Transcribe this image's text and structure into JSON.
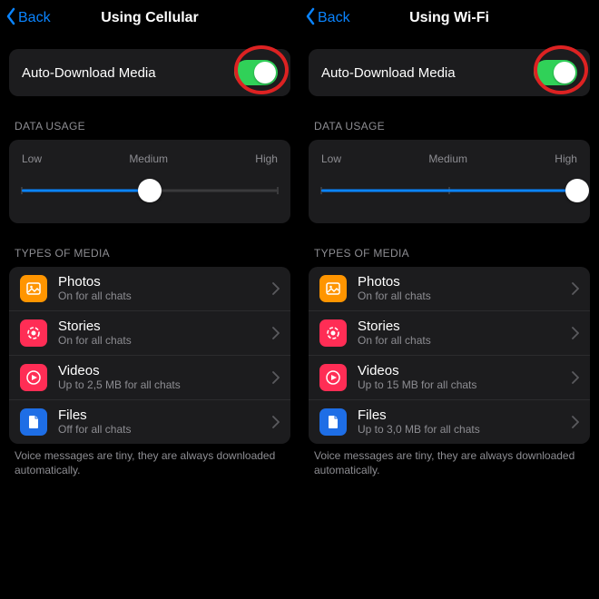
{
  "panes": [
    {
      "back": "Back",
      "title": "Using Cellular",
      "auto": {
        "label": "Auto-Download Media",
        "on": true
      },
      "dataUsage": {
        "header": "DATA USAGE",
        "low": "Low",
        "medium": "Medium",
        "high": "High",
        "valuePct": 50
      },
      "types": {
        "header": "TYPES OF MEDIA",
        "items": [
          {
            "icon": "photos",
            "title": "Photos",
            "sub": "On for all chats"
          },
          {
            "icon": "stories",
            "title": "Stories",
            "sub": "On for all chats"
          },
          {
            "icon": "videos",
            "title": "Videos",
            "sub": "Up to 2,5 MB for all chats"
          },
          {
            "icon": "files",
            "title": "Files",
            "sub": "Off for all chats"
          }
        ],
        "footnote": "Voice messages are tiny, they are always downloaded automatically."
      }
    },
    {
      "back": "Back",
      "title": "Using Wi-Fi",
      "auto": {
        "label": "Auto-Download Media",
        "on": true
      },
      "dataUsage": {
        "header": "DATA USAGE",
        "low": "Low",
        "medium": "Medium",
        "high": "High",
        "valuePct": 100
      },
      "types": {
        "header": "TYPES OF MEDIA",
        "items": [
          {
            "icon": "photos",
            "title": "Photos",
            "sub": "On for all chats"
          },
          {
            "icon": "stories",
            "title": "Stories",
            "sub": "On for all chats"
          },
          {
            "icon": "videos",
            "title": "Videos",
            "sub": "Up to 15 MB for all chats"
          },
          {
            "icon": "files",
            "title": "Files",
            "sub": "Up to 3,0 MB for all chats"
          }
        ],
        "footnote": "Voice messages are tiny, they are always downloaded automatically."
      }
    }
  ],
  "colors": {
    "accent": "#0a84ff",
    "toggleOn": "#30d158",
    "ring": "#d22"
  }
}
